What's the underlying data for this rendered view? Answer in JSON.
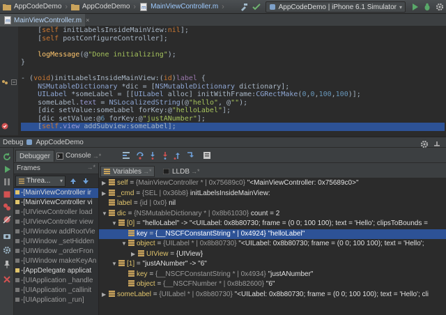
{
  "navbar": {
    "crumbs": [
      {
        "label": "AppCodeDemo"
      },
      {
        "label": "AppCodeDemo"
      },
      {
        "label": "MainViewController.m"
      }
    ],
    "run_config": "AppCodeDemo | iPhone 6.1 Simulator"
  },
  "editor": {
    "tab": "MainViewController.m",
    "tab_close": "×"
  },
  "code": [
    {
      "segments": [
        {
          "t": "    [",
          "c": ""
        },
        {
          "t": "self",
          "c": "kw"
        },
        {
          "t": " initLabelsInsideMainView:",
          "c": ""
        },
        {
          "t": "nil",
          "c": "kw"
        },
        {
          "t": "];",
          "c": ""
        }
      ]
    },
    {
      "segments": [
        {
          "t": "    [",
          "c": ""
        },
        {
          "t": "self",
          "c": "kw"
        },
        {
          "t": " postConfigureController];",
          "c": ""
        }
      ]
    },
    {
      "segments": [
        {
          "t": "",
          "c": ""
        }
      ]
    },
    {
      "segments": [
        {
          "t": "    ",
          "c": ""
        },
        {
          "t": "logMessage",
          "c": "fn"
        },
        {
          "t": "(@",
          "c": ""
        },
        {
          "t": "\"Done initializing\"",
          "c": "str"
        },
        {
          "t": ");",
          "c": ""
        }
      ]
    },
    {
      "segments": [
        {
          "t": "}",
          "c": ""
        }
      ]
    },
    {
      "segments": [
        {
          "t": "",
          "c": ""
        }
      ]
    },
    {
      "segments": [
        {
          "t": "- (",
          "c": ""
        },
        {
          "t": "void",
          "c": "kw"
        },
        {
          "t": ")initLabelsInsideMainView:(",
          "c": ""
        },
        {
          "t": "id",
          "c": "kw"
        },
        {
          "t": ")",
          "c": ""
        },
        {
          "t": "label",
          "c": "lbl"
        },
        {
          "t": " {",
          "c": ""
        }
      ]
    },
    {
      "segments": [
        {
          "t": "    ",
          "c": ""
        },
        {
          "t": "NSMutableDictionary",
          "c": "ty"
        },
        {
          "t": " *dic = [",
          "c": ""
        },
        {
          "t": "NSMutableDictionary",
          "c": "ty"
        },
        {
          "t": " dictionary];",
          "c": ""
        }
      ]
    },
    {
      "segments": [
        {
          "t": "    ",
          "c": ""
        },
        {
          "t": "UILabel",
          "c": "ty"
        },
        {
          "t": " *someLabel = [[",
          "c": ""
        },
        {
          "t": "UILabel",
          "c": "ty"
        },
        {
          "t": " alloc] initWithFrame:",
          "c": ""
        },
        {
          "t": "CGRectMake",
          "c": "ty"
        },
        {
          "t": "(",
          "c": ""
        },
        {
          "t": "0",
          "c": "num"
        },
        {
          "t": ",",
          "c": ""
        },
        {
          "t": "0",
          "c": "num"
        },
        {
          "t": ",",
          "c": ""
        },
        {
          "t": "100",
          "c": "num"
        },
        {
          "t": ",",
          "c": ""
        },
        {
          "t": "100",
          "c": "num"
        },
        {
          "t": ")];",
          "c": ""
        }
      ]
    },
    {
      "segments": [
        {
          "t": "    someLabel.",
          "c": ""
        },
        {
          "t": "text",
          "c": "ref"
        },
        {
          "t": " = ",
          "c": ""
        },
        {
          "t": "NSLocalizedString",
          "c": "ty"
        },
        {
          "t": "(@",
          "c": ""
        },
        {
          "t": "\"hello\"",
          "c": "str"
        },
        {
          "t": ", @",
          "c": ""
        },
        {
          "t": "\"\"",
          "c": "str"
        },
        {
          "t": ");",
          "c": ""
        }
      ]
    },
    {
      "segments": [
        {
          "t": "    [dic setValue:someLabel forKey:@",
          "c": ""
        },
        {
          "t": "\"helloLabel\"",
          "c": "str"
        },
        {
          "t": "];",
          "c": ""
        }
      ]
    },
    {
      "segments": [
        {
          "t": "    [dic setValue:@",
          "c": ""
        },
        {
          "t": "6",
          "c": "num"
        },
        {
          "t": " forKey:@",
          "c": ""
        },
        {
          "t": "\"justANumber\"",
          "c": "str"
        },
        {
          "t": "];",
          "c": ""
        }
      ]
    },
    {
      "segments": [
        {
          "t": "    [",
          "c": ""
        },
        {
          "t": "self",
          "c": "kw"
        },
        {
          "t": ".",
          "c": ""
        },
        {
          "t": "view",
          "c": "ref"
        },
        {
          "t": " addSubview:someLabel];",
          "c": ""
        }
      ],
      "highlighted": true
    }
  ],
  "debug": {
    "title": "Debug",
    "config": "AppCodeDemo",
    "tabs": {
      "debugger": "Debugger",
      "console": "Console",
      "console_suffix": "→*"
    },
    "frames_title": "Frames",
    "frames_pin": "→*",
    "thread_select": "Threa...",
    "frames": [
      {
        "label": "-[MainViewController ir",
        "selected": true,
        "mine": true
      },
      {
        "label": "-[MainViewController vi",
        "mine": true
      },
      {
        "label": "-[UIViewController load"
      },
      {
        "label": "-[UIViewController view"
      },
      {
        "label": "-[UIWindow addRootVie"
      },
      {
        "label": "-[UIWindow _setHidden"
      },
      {
        "label": "-[UIWindow _orderFron"
      },
      {
        "label": "-[UIWindow makeKeyAn"
      },
      {
        "label": "-[AppDelegate applicat",
        "mine": true
      },
      {
        "label": "-[UIApplication _handle"
      },
      {
        "label": "-[UIApplication _callinit"
      },
      {
        "label": "-[UIApplication _run]"
      }
    ],
    "vars_tabs": {
      "variables": "Variables",
      "variables_suffix": "→*",
      "lldb": "LLDB",
      "lldb_suffix": "→*"
    },
    "variables": [
      {
        "depth": 0,
        "tri": "▶",
        "name": "self",
        "type": "{MainViewController * | 0x75689c0}",
        "value": "\"<MainViewController: 0x75689c0>\""
      },
      {
        "depth": 0,
        "tri": "▶",
        "name": "_cmd",
        "type": "{SEL | 0x36b8}",
        "value": "initLabelsInsideMainView:"
      },
      {
        "depth": 0,
        "tri": "",
        "name": "label",
        "type": "{id | 0x0}",
        "value": "nil"
      },
      {
        "depth": 0,
        "tri": "▼",
        "name": "dic",
        "type": "{NSMutableDictionary * | 0x8b61030}",
        "value": "count = 2"
      },
      {
        "depth": 1,
        "tri": "▼",
        "name": "[0]",
        "type": "",
        "value": "\"helloLabel\" -> \"<UILabel: 0x8b80730; frame = (0 0; 100 100); text = 'Hello'; clipsToBounds ="
      },
      {
        "depth": 2,
        "tri": "",
        "name": "key",
        "type": "{__NSCFConstantString * | 0x4924}",
        "value": "\"helloLabel\"",
        "selected": true
      },
      {
        "depth": 2,
        "tri": "▼",
        "name": "object",
        "type": "{UILabel * | 0x8b80730}",
        "value": "\"<UILabel: 0x8b80730; frame = (0 0; 100 100); text = 'Hello';"
      },
      {
        "depth": 3,
        "tri": "▶",
        "name": "UIView",
        "type": "",
        "value": "{UIView}"
      },
      {
        "depth": 1,
        "tri": "▼",
        "name": "[1]",
        "type": "",
        "value": "\"justANumber\" -> \"6\""
      },
      {
        "depth": 2,
        "tri": "",
        "name": "key",
        "type": "{__NSCFConstantString * | 0x4934}",
        "value": "\"justANumber\""
      },
      {
        "depth": 2,
        "tri": "",
        "name": "object",
        "type": "{__NSCFNumber * | 0x8b82600}",
        "value": "\"6\""
      },
      {
        "depth": 0,
        "tri": "▶",
        "name": "someLabel",
        "type": "{UILabel * | 0x8b80730}",
        "value": "\"<UILabel: 0x8b80730; frame = (0 0; 100 100); text = 'Hello'; cli"
      }
    ]
  },
  "colors": {
    "accent_selection": "#2d5296",
    "keyword": "#cc7832",
    "string": "#a5c25c",
    "number": "#6897bb"
  }
}
